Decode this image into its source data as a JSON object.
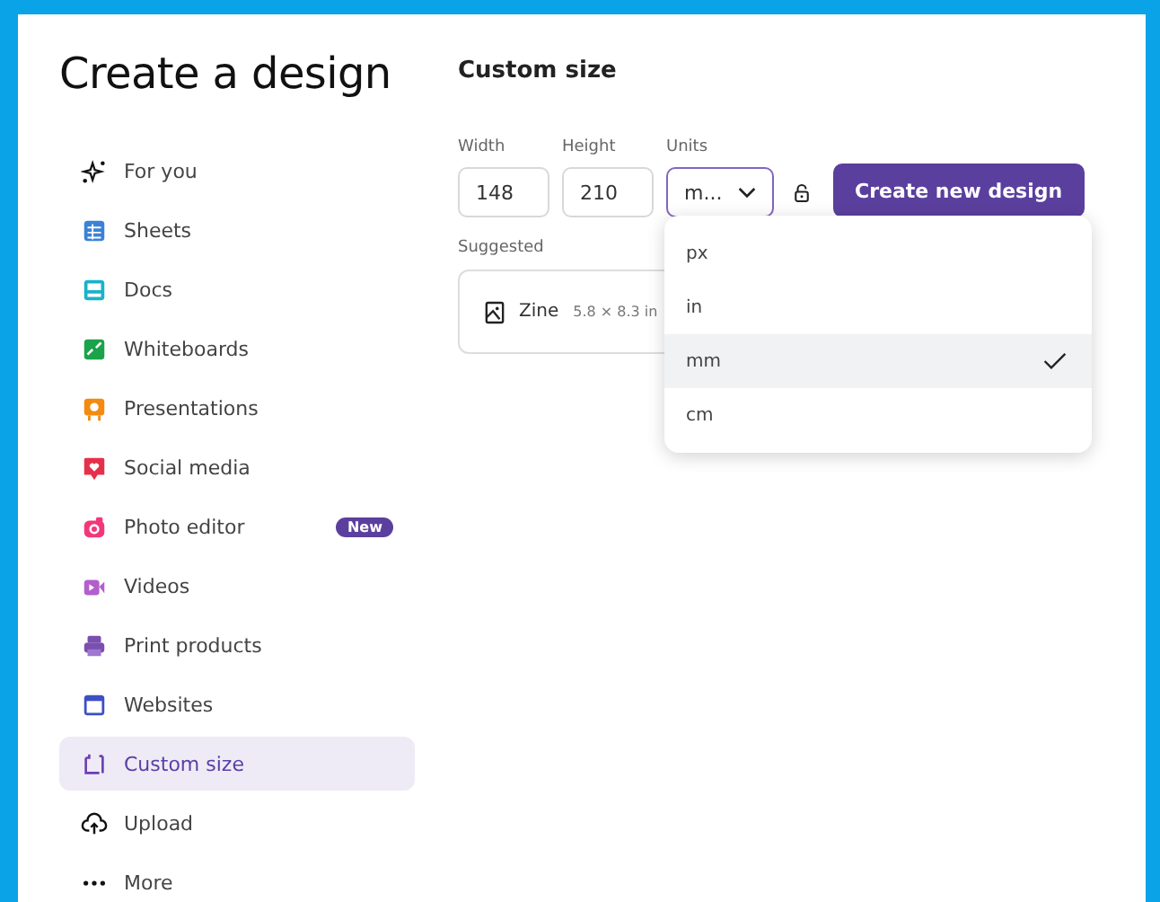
{
  "title": "Create a design",
  "sidebar": {
    "items": [
      {
        "label": "For you",
        "selected": false
      },
      {
        "label": "Sheets",
        "selected": false
      },
      {
        "label": "Docs",
        "selected": false
      },
      {
        "label": "Whiteboards",
        "selected": false
      },
      {
        "label": "Presentations",
        "selected": false
      },
      {
        "label": "Social media",
        "selected": false
      },
      {
        "label": "Photo editor",
        "selected": false,
        "badge": "New"
      },
      {
        "label": "Videos",
        "selected": false
      },
      {
        "label": "Print products",
        "selected": false
      },
      {
        "label": "Websites",
        "selected": false
      },
      {
        "label": "Custom size",
        "selected": true
      },
      {
        "label": "Upload",
        "selected": false
      },
      {
        "label": "More",
        "selected": false
      }
    ]
  },
  "panel": {
    "heading": "Custom size",
    "width": {
      "label": "Width",
      "value": "148"
    },
    "height": {
      "label": "Height",
      "value": "210"
    },
    "units": {
      "label": "Units",
      "value": "m...",
      "expanded": true,
      "options": [
        {
          "label": "px",
          "selected": false
        },
        {
          "label": "in",
          "selected": false
        },
        {
          "label": "mm",
          "selected": true
        },
        {
          "label": "cm",
          "selected": false
        }
      ]
    },
    "create_button": "Create new design",
    "suggested_label": "Suggested",
    "suggested": [
      {
        "name": "Zine",
        "size": "5.8 × 8.3 in"
      }
    ]
  }
}
